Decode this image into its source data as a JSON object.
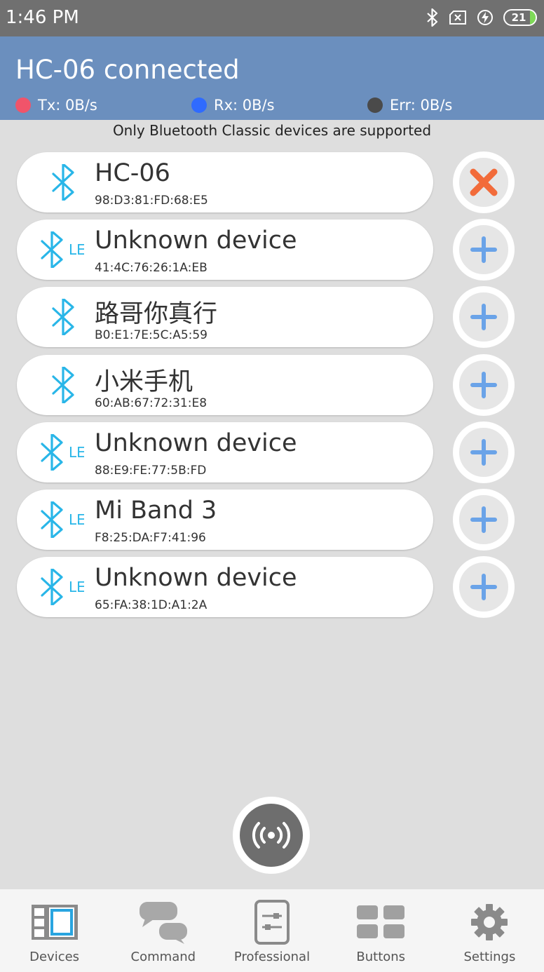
{
  "status_bar": {
    "time": "1:46 PM",
    "battery": "21",
    "icons": [
      "bluetooth-icon",
      "no-sim-icon",
      "charging-icon",
      "battery-icon"
    ]
  },
  "header": {
    "title": "HC-06 connected",
    "tx": "Tx: 0B/s",
    "rx": "Rx: 0B/s",
    "err": "Err: 0B/s",
    "colors": {
      "background": "#6b8fbe",
      "tx": "#f0546a",
      "rx": "#2f6bff",
      "err": "#4a4a4a"
    }
  },
  "notice": "Only Bluetooth Classic devices are supported",
  "colors": {
    "bt_icon": "#29b6e8",
    "remove": "#f26b3a",
    "add": "#6aa3e8"
  },
  "devices": [
    {
      "name": "HC-06",
      "mac": "98:D3:81:FD:68:E5",
      "type": "classic",
      "action": "remove"
    },
    {
      "name": "Unknown device",
      "mac": "41:4C:76:26:1A:EB",
      "type": "ble",
      "ble_tag": "LE",
      "action": "add"
    },
    {
      "name": "路哥你真行",
      "mac": "B0:E1:7E:5C:A5:59",
      "type": "classic",
      "action": "add"
    },
    {
      "name": "小米手机",
      "mac": "60:AB:67:72:31:E8",
      "type": "classic",
      "action": "add"
    },
    {
      "name": "Unknown device",
      "mac": "88:E9:FE:77:5B:FD",
      "type": "ble",
      "ble_tag": "LE",
      "action": "add"
    },
    {
      "name": "Mi Band 3",
      "mac": "F8:25:DA:F7:41:96",
      "type": "ble",
      "ble_tag": "LE",
      "action": "add"
    },
    {
      "name": "Unknown device",
      "mac": "65:FA:38:1D:A1:2A",
      "type": "ble",
      "ble_tag": "LE",
      "action": "add"
    }
  ],
  "fab": {
    "icon": "broadcast-icon"
  },
  "nav": [
    {
      "label": "Devices",
      "icon": "devices-icon",
      "active": true
    },
    {
      "label": "Command",
      "icon": "command-icon"
    },
    {
      "label": "Professional",
      "icon": "professional-icon"
    },
    {
      "label": "Buttons",
      "icon": "buttons-icon"
    },
    {
      "label": "Settings",
      "icon": "settings-icon"
    }
  ]
}
